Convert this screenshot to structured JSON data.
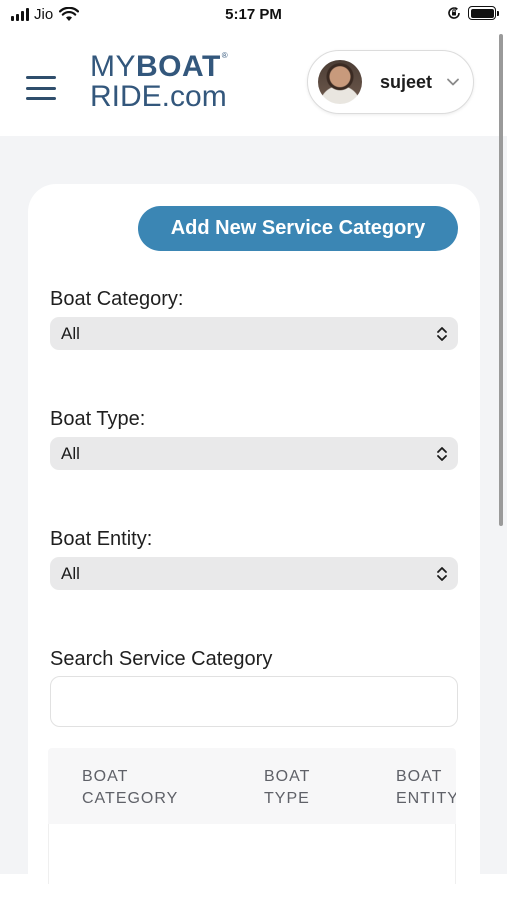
{
  "status_bar": {
    "carrier": "Jio",
    "time": "5:17 PM"
  },
  "header": {
    "logo_my": "MY",
    "logo_boat": "BOAT",
    "logo_line2": "RIDE.com",
    "logo_mark": "®",
    "user_name": "sujeet"
  },
  "card": {
    "add_button_label": "Add New Service Category",
    "boat_category": {
      "label": "Boat Category:",
      "value": "All"
    },
    "boat_type": {
      "label": "Boat Type:",
      "value": "All"
    },
    "boat_entity": {
      "label": "Boat Entity:",
      "value": "All"
    },
    "search": {
      "label": "Search Service Category",
      "value": "",
      "placeholder": ""
    },
    "table": {
      "columns": [
        "BOAT\nCATEGORY",
        "BOAT\nTYPE",
        "BOAT\nENTITY"
      ]
    }
  },
  "colors": {
    "brand": "#33577c",
    "button": "#3b86b4",
    "background": "#f3f4f6"
  },
  "icons": [
    "signal-icon",
    "wifi-icon",
    "orientation-lock-icon",
    "battery-icon",
    "menu-icon",
    "chevron-down-icon",
    "select-arrows-icon"
  ]
}
